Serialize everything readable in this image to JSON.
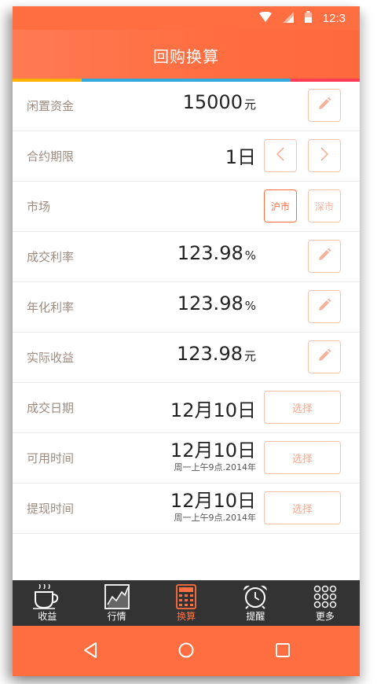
{
  "status_bar": {
    "time": "12:3"
  },
  "header": {
    "title": "回购换算"
  },
  "rows": {
    "idle_funds": {
      "label": "闲置资金",
      "value": "15000",
      "unit": "元"
    },
    "term": {
      "label": "合约期限",
      "value": "1日"
    },
    "market": {
      "label": "市场",
      "options": [
        "沪市",
        "深市"
      ],
      "selected": "沪市"
    },
    "deal_rate": {
      "label": "成交利率",
      "value": "123.98",
      "unit": "%"
    },
    "annual_rate": {
      "label": "年化利率",
      "value": "123.98",
      "unit": "%"
    },
    "actual_income": {
      "label": "实际收益",
      "value": "123.98",
      "unit": "元"
    },
    "deal_date": {
      "label": "成交日期",
      "value": "12月10日",
      "button": "选择"
    },
    "available_time": {
      "label": "可用时间",
      "value": "12月10日",
      "sub": "周一上午9点.2014年",
      "button": "选择"
    },
    "withdraw_time": {
      "label": "提现时间",
      "value": "12月10日",
      "sub": "周一上午9点.2014年",
      "button": "选择"
    }
  },
  "bottom_nav": [
    {
      "label": "收益",
      "icon": "cup-icon"
    },
    {
      "label": "行情",
      "icon": "chart-icon"
    },
    {
      "label": "换算",
      "icon": "calculator-icon",
      "active": true
    },
    {
      "label": "提醒",
      "icon": "alarm-clock-icon"
    },
    {
      "label": "更多",
      "icon": "grid-dots-icon"
    }
  ],
  "colors": {
    "accent": "#ff6e40",
    "nav_bg": "#333333",
    "label": "#9d8b80",
    "border_soft": "#f8c3b1"
  }
}
